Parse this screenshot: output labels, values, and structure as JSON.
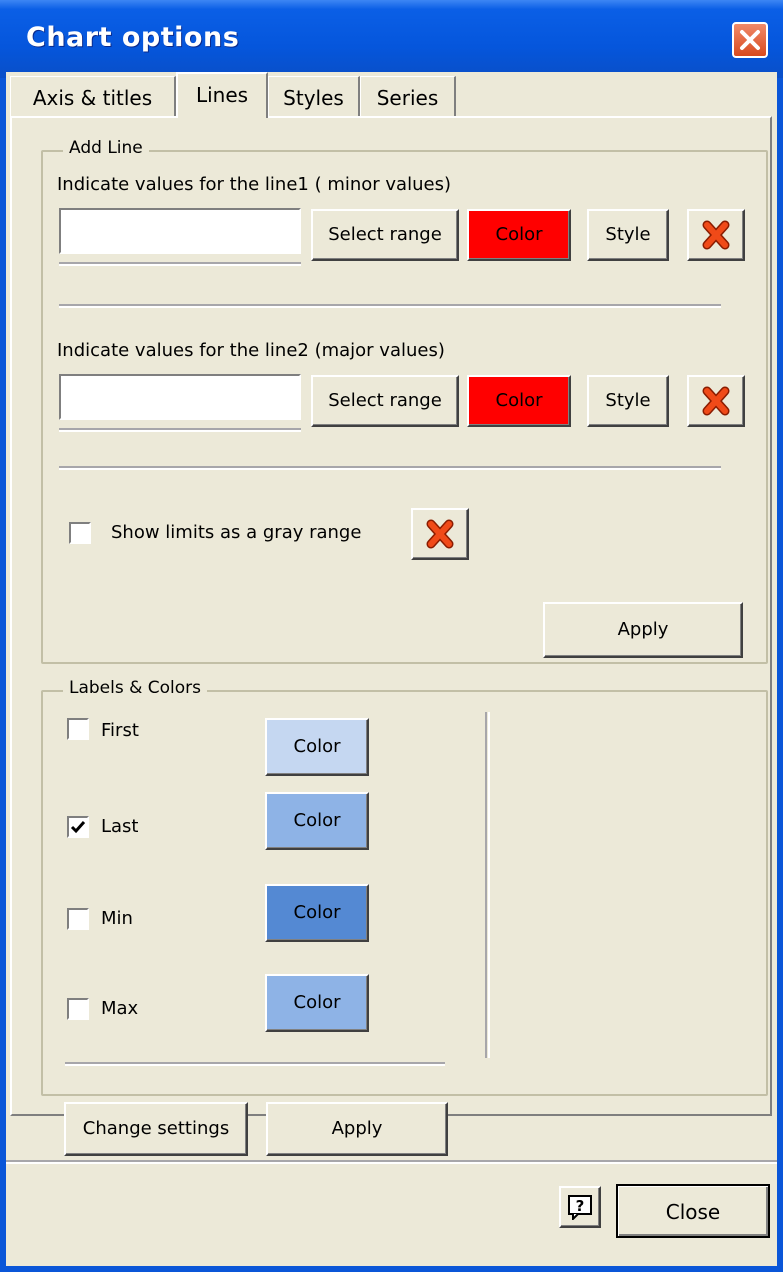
{
  "window": {
    "title": "Chart options"
  },
  "tabs": [
    {
      "label": "Axis & titles"
    },
    {
      "label": "Lines"
    },
    {
      "label": "Styles"
    },
    {
      "label": "Series"
    }
  ],
  "add_line": {
    "legend": "Add Line",
    "line1": {
      "label": "Indicate values for the line1 ( minor values)",
      "value": "",
      "select_range": "Select range",
      "color": "Color",
      "color_hex": "#ff0000",
      "style": "Style"
    },
    "line2": {
      "label": "Indicate values for the line2 (major values)",
      "value": "",
      "select_range": "Select range",
      "color": "Color",
      "color_hex": "#ff0000",
      "style": "Style"
    },
    "gray_range": {
      "label": "Show limits as a gray range",
      "checked": false
    },
    "apply": "Apply"
  },
  "labels_colors": {
    "legend": "Labels & Colors",
    "items": [
      {
        "label": "First",
        "checked": false,
        "color": "Color",
        "color_hex": "#c5d7f1"
      },
      {
        "label": "Last",
        "checked": true,
        "color": "Color",
        "color_hex": "#8eb3e6"
      },
      {
        "label": "Min",
        "checked": false,
        "color": "Color",
        "color_hex": "#5489d3"
      },
      {
        "label": "Max",
        "checked": false,
        "color": "Color",
        "color_hex": "#8eb3e6"
      }
    ],
    "change_settings": "Change settings",
    "apply": "Apply"
  },
  "footer": {
    "close": "Close"
  },
  "icons": {
    "delete": "red-x-icon",
    "help": "help-icon",
    "close": "close-icon"
  }
}
